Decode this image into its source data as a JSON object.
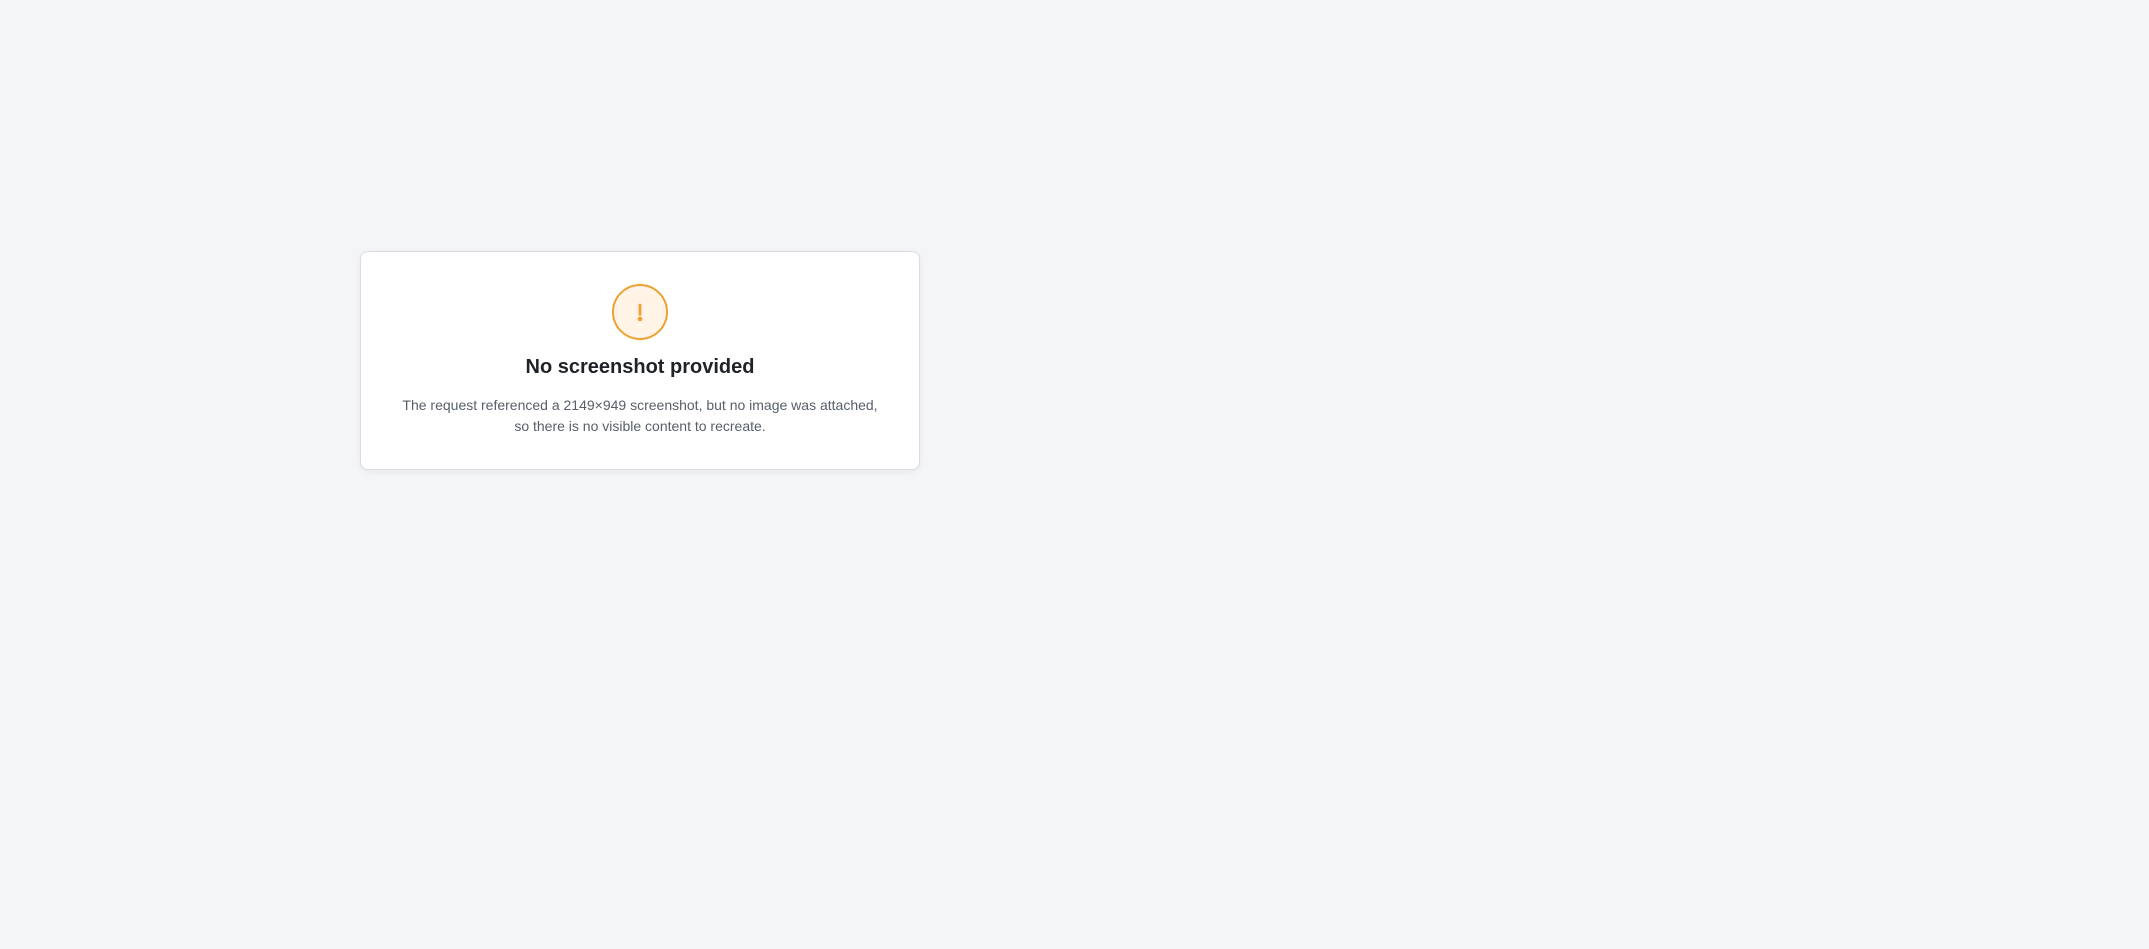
{
  "notice": {
    "heading": "No screenshot provided",
    "message": "The request referenced a 2149×949 screenshot, but no image was attached, so there is no visible content to recreate."
  },
  "icon": {
    "name": "warning-icon",
    "color": "#f0a030"
  }
}
